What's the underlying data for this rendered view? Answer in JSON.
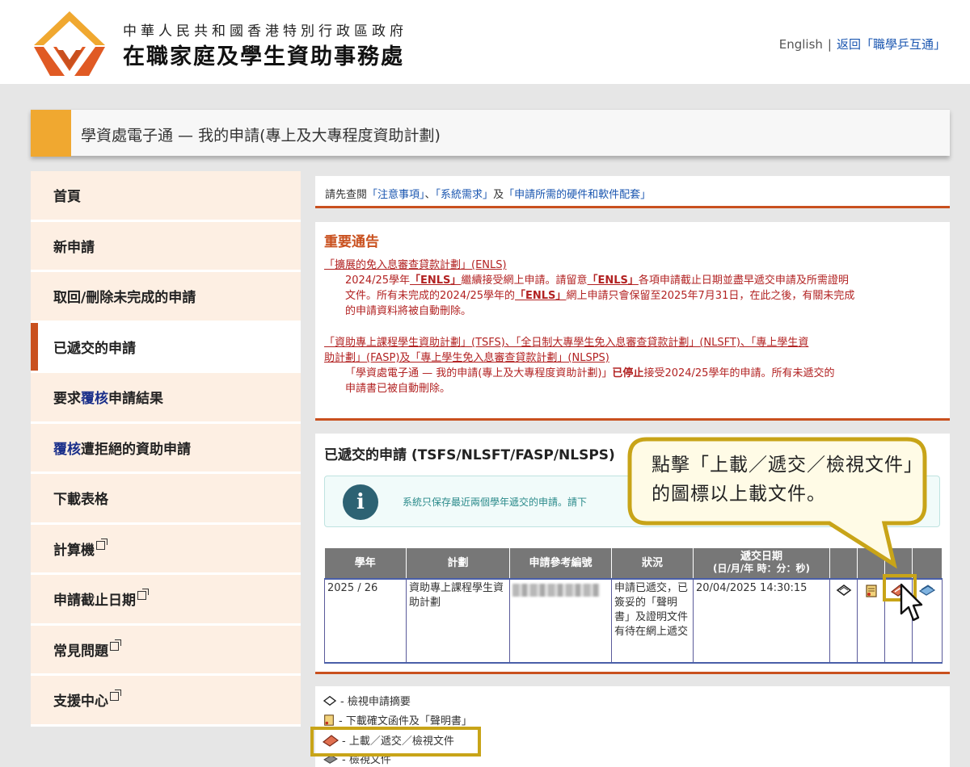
{
  "header": {
    "gov_name": "中華人民共和國香港特別行政區政府",
    "office_name": "在職家庭及學生資助事務處",
    "link_english": "English",
    "separator": "|",
    "link_return": "返回「職學乒互通」"
  },
  "title_bar": {
    "title": "學資處電子通 — 我的申請(專上及大專程度資助計劃)"
  },
  "sidebar": {
    "items": [
      {
        "label": "首頁"
      },
      {
        "label": "新申請"
      },
      {
        "label": "取回/刪除未完成的申請"
      },
      {
        "label": "已遞交的申請"
      },
      {
        "label_pre": "要求",
        "label_blue": "覆核",
        "label_post": "申請結果"
      },
      {
        "label_blue": "覆核",
        "label_post": "遭拒絕的資助申請"
      },
      {
        "label": "下載表格"
      },
      {
        "label": "計算機"
      },
      {
        "label": "申請截止日期"
      },
      {
        "label": "常見問題"
      },
      {
        "label": "支援中心"
      }
    ]
  },
  "notice": {
    "pre": "請先查閱",
    "link1": "「注意事項」",
    "sep": "、",
    "link2": "「系統需求」",
    "mid": "及",
    "link3": "「申請所需的硬件和軟件配套」"
  },
  "important": {
    "title": "重要通告",
    "b1_heading": "「擴展的免入息審查貸款計劃」(ENLS)",
    "b1_l1_pre": "2024/25學年",
    "b1_l1_bold1": "「ENLS」",
    "b1_l1_mid": "繼續接受網上申請。請留意",
    "b1_l1_bold2": "「ENLS」",
    "b1_l1_post": "各項申請截止日期並盡早遞交申請及所需證明",
    "b1_l2": "文件。所有未完成的2024/25學年的",
    "b1_l2_bold": "「ENLS」",
    "b1_l2_post": "網上申請只會保留至2025年7月31日，在此之後，有關未完成",
    "b1_l3": "的申請資料將被自動刪除。",
    "b2_heading_l1": "「資助專上課程學生資助計劃」(TSFS)、「全日制大專學生免入息審查貸款計劃」(NLSFT)、「專上學生資",
    "b2_heading_l2": "助計劃」(FASP)及「專上學生免入息審查貸款計劃」(NLSPS)",
    "b2_l1_pre": "「學資處電子通 — 我的申請(專上及大專程度資助計劃)」",
    "b2_l1_bold": "已停止",
    "b2_l1_post": "接受2024/25學年的申請。所有未遞交的",
    "b2_l2": "申請書已被自動刪除。"
  },
  "submitted": {
    "title": "已遞交的申請 (TSFS/NLSFT/FASP/NLSPS)",
    "info_icon": "i",
    "info_text": "系統只保存最近兩個學年遞交的申請。請下",
    "table": {
      "headers": [
        "學年",
        "計劃",
        "申請參考編號",
        "狀況"
      ],
      "date_header": "遞交日期",
      "date_header_sub": "(日/月/年 時：分：秒)",
      "row": {
        "year": "2025 / 26",
        "scheme": "資助專上課程學生資助計劃",
        "status": "申請已遞交，已簽妥的「聲明書」及證明文件有待在網上遞交",
        "date": "20/04/2025 14:30:15"
      }
    }
  },
  "legend": {
    "items": [
      {
        "label": "- 檢視申請摘要",
        "icon": "view-summary-icon"
      },
      {
        "label": "- 下載確文函件及「聲明書」",
        "icon": "download-letter-icon"
      },
      {
        "label": "- 上載／遞交／檢視文件",
        "icon": "upload-document-icon"
      },
      {
        "label": "- 檢視文件",
        "icon": "view-document-icon"
      }
    ]
  },
  "callout": {
    "text": "點擊「上載／遞交／檢視文件」的圖標以上載文件。"
  },
  "colors": {
    "accent_orange": "#f0a830",
    "brand_red": "#c9501e",
    "highlight_gold": "#c8a418"
  }
}
